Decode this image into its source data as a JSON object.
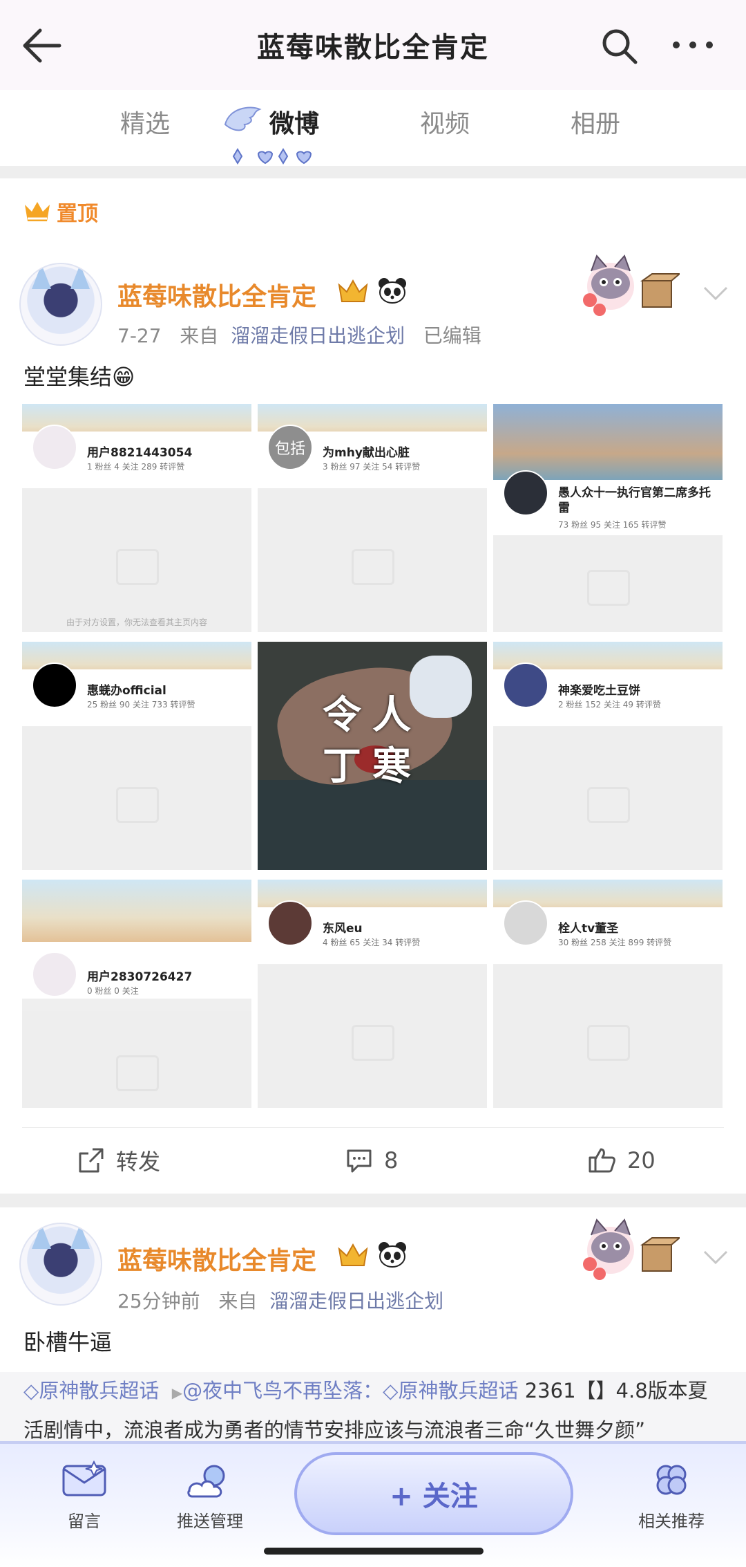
{
  "header": {
    "title": "蓝莓味散比全肯定"
  },
  "tabs": [
    {
      "label": "精选"
    },
    {
      "label": "微博"
    },
    {
      "label": "视频"
    },
    {
      "label": "相册"
    }
  ],
  "pinned_label": "置顶",
  "post1": {
    "author": "蓝莓味散比全肯定",
    "date": "7-27",
    "from_prefix": "来自",
    "source": "溜溜走假日出逃企划",
    "edited": "已编辑",
    "text": "堂堂集结😁",
    "grid": [
      {
        "name": "用户8821443054",
        "stats": "1 粉丝   4 关注   289 转评赞",
        "note": "由于对方设置，你无法查看其主页内容"
      },
      {
        "name": "为mhy献出心脏",
        "avatar_text": "包括",
        "stats": "3 粉丝   97 关注   54 转评赞",
        "note": ""
      },
      {
        "name": "愚人众十一执行官第二席多托雷",
        "stats": "73 粉丝   95 关注   165 转评赞",
        "note": ""
      },
      {
        "name": "惠蜣办official",
        "stats": "25 粉丝   90 关注   733 转评赞",
        "note": ""
      },
      {
        "caption_line1": "令人",
        "caption_line2": "丁寒"
      },
      {
        "name": "神楽爱吃土豆饼",
        "stats": "2 粉丝   152 关注   49 转评赞",
        "note": ""
      },
      {
        "name": "用户2830726427",
        "stats": "0 粉丝   0 关注",
        "note": ""
      },
      {
        "name": "东风eu",
        "stats": "4 粉丝   65 关注   34 转评赞",
        "note": ""
      },
      {
        "name": "栓人tv董圣",
        "stats": "30 粉丝   258 关注   899 转评赞",
        "note": ""
      }
    ],
    "repost_label": "转发",
    "comments": "8",
    "likes": "20"
  },
  "post2": {
    "author": "蓝莓味散比全肯定",
    "time": "25分钟前",
    "from_prefix": "来自",
    "source": "溜溜走假日出逃企划",
    "text": "卧槽牛逼",
    "repost_topic": "原神散兵超话",
    "repost_user": "@夜中飞鸟不再坠落：",
    "repost_topic2": "原神散兵超话",
    "repost_text": " 2361【】4.8版本夏活剧情中，流浪者成为勇者的情节安排应该与流浪者三命“久世舞夕颜”"
  },
  "bottombar": {
    "message": "留言",
    "push": "推送管理",
    "follow": "+ 关注",
    "related": "相关推荐"
  },
  "colors": {
    "author": "#e8892b",
    "topic": "#6f7fc4",
    "accent": "#9faaf0"
  }
}
